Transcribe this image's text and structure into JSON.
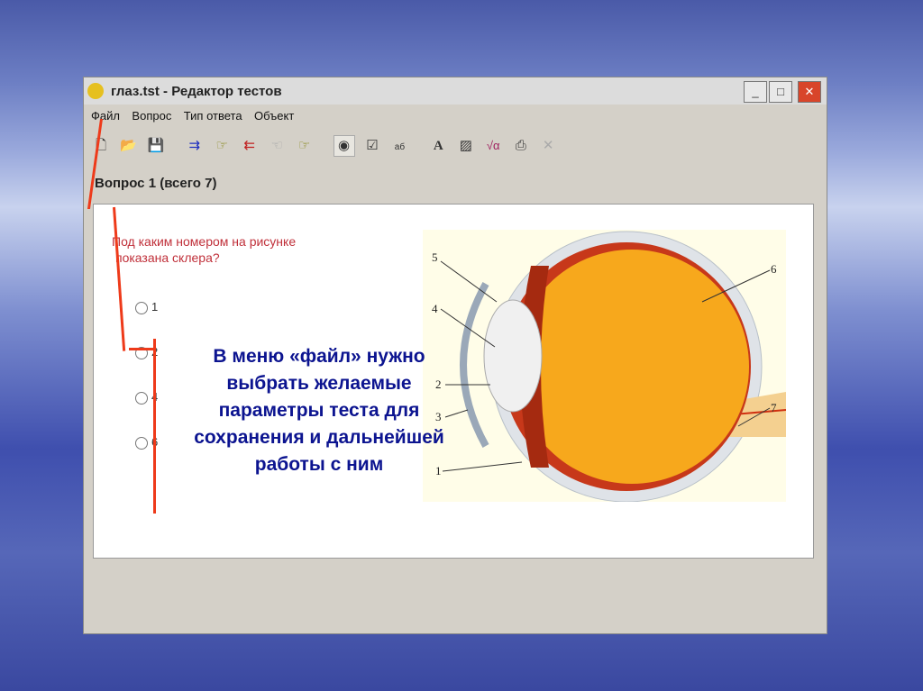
{
  "window": {
    "title": "глаз.tst - Редактор тестов",
    "controls": [
      "minimize",
      "maximize",
      "close"
    ]
  },
  "menu": [
    "Файл",
    "Вопрос",
    "Тип ответа",
    "Объект"
  ],
  "toolbar": [
    {
      "icon": "new-file-icon",
      "glyph": "🗋"
    },
    {
      "icon": "open-folder-icon",
      "glyph": "📂"
    },
    {
      "icon": "save-icon",
      "glyph": "💾"
    },
    {
      "icon": "add-question-icon",
      "glyph": "⇉"
    },
    {
      "icon": "goto-question-icon",
      "glyph": "☞"
    },
    {
      "icon": "remove-question-icon",
      "glyph": "⇇"
    },
    {
      "icon": "previous-icon",
      "glyph": "☜"
    },
    {
      "icon": "next-icon",
      "glyph": "☞"
    },
    {
      "icon": "single-choice-icon",
      "glyph": "◉"
    },
    {
      "icon": "multiple-choice-icon",
      "glyph": "☑"
    },
    {
      "icon": "text-answer-icon",
      "glyph": "аб"
    },
    {
      "icon": "text-icon",
      "glyph": "A"
    },
    {
      "icon": "image-icon",
      "glyph": "▨"
    },
    {
      "icon": "formula-icon",
      "glyph": "√α"
    },
    {
      "icon": "object-icon",
      "glyph": "⎙"
    },
    {
      "icon": "delete-icon",
      "glyph": "✕"
    }
  ],
  "heading": "Вопрос 1 (всего 7)",
  "question": {
    "line1": "Под каким номером на рисунке",
    "line2": "показана склера?"
  },
  "options": [
    "1",
    "2",
    "4",
    "6"
  ],
  "figure_labels": [
    "1",
    "2",
    "3",
    "4",
    "5",
    "6",
    "7"
  ],
  "overlay_text": "В меню «файл» нужно выбрать желаемые параметры теста для сохранения и дальнейшей работы с ним",
  "colors": {
    "annotation_line": "#ee3a1a",
    "overlay_text": "#0c1490",
    "question_text": "#c0303a"
  }
}
